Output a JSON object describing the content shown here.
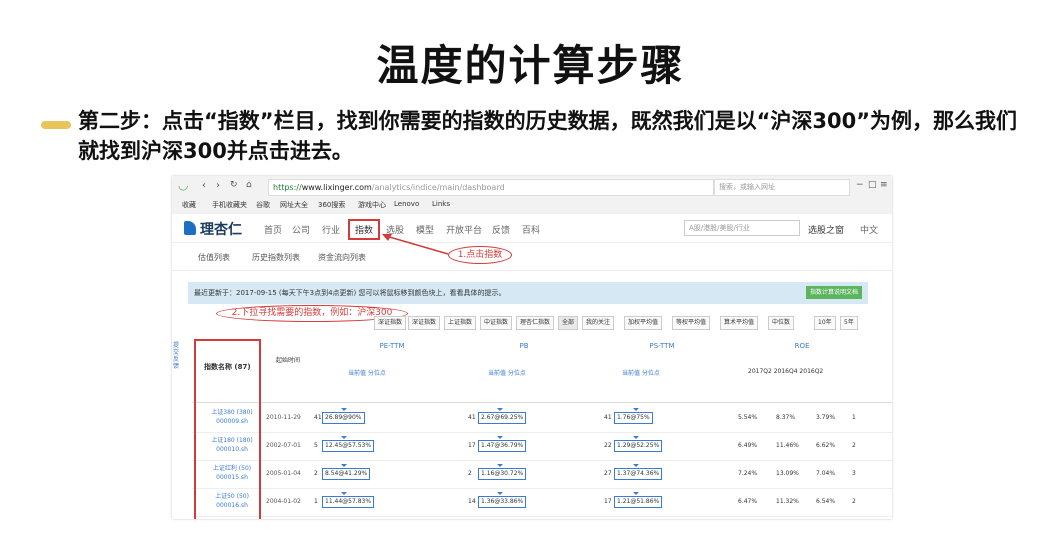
{
  "slide": {
    "title": "温度的计算步骤",
    "step_text": "第二步：点击“指数”栏目，找到你需要的指数的历史数据，既然我们是以“沪深300”为例，那么我们就找到沪深300并点击进去。"
  },
  "browser": {
    "url_scheme": "https://",
    "url_host": "www.lixinger.com",
    "url_path": "/analytics/indice/main/dashboard",
    "bookmarks": [
      "收藏",
      "手机收藏夹",
      "谷歌",
      "网址大全",
      "360搜索",
      "游戏中心",
      "Lenovo",
      "Links"
    ],
    "search_placeholder": "搜索，或输入网址"
  },
  "site": {
    "logo": "理杏仁",
    "nav": [
      "首页",
      "公司",
      "行业",
      "指数",
      "选股",
      "模型",
      "开放平台",
      "反馈",
      "百科"
    ],
    "active_nav": "指数",
    "search_placeholder": "A股/港股/美股/行业",
    "user": "选股之窗",
    "lang": "中文"
  },
  "subtabs": [
    "估值列表",
    "历史指数列表",
    "资金流向列表"
  ],
  "callouts": {
    "click_index": "1.点击指数",
    "scroll_find": "2.下拉寻找需要的指数，例如：沪深300"
  },
  "infobar": {
    "text": "最近更新于：2017-09-15 (每天下午3点到4点更新) 您可以将鼠标移到颜色块上，看看具体的提示。",
    "button": "指数计算说明文档"
  },
  "filters": {
    "left": [
      "深证指数",
      "深证指数",
      "上证指数",
      "中证指数",
      "理杏仁指数",
      "全部",
      "我的关注"
    ],
    "right": [
      "加权平均值",
      "等权平均值",
      "算术平均值",
      "中位数",
      "10年",
      "5年"
    ]
  },
  "table": {
    "col_name": "指数名称 (87)",
    "col_date": "起始时间",
    "groups": [
      "PE-TTM",
      "PB",
      "PS-TTM",
      "ROE"
    ],
    "sub_pe": "当前值  分位点",
    "roe_years": "2017Q2  2016Q4  2016Q2",
    "rows": [
      {
        "name": "上证380 (380)",
        "code": "000009.sh",
        "date": "2010-11-29",
        "pe_n": "41",
        "pe": "26.89@90%",
        "pb_n": "41",
        "pb": "2.67@69.25%",
        "ps_n": "41",
        "ps": "1.76@75%",
        "roe": [
          "5.54%",
          "8.37%",
          "3.79%",
          "1"
        ]
      },
      {
        "name": "上证180 (180)",
        "code": "000010.sh",
        "date": "2002-07-01",
        "pe_n": "5",
        "pe": "12.45@57.53%",
        "pb_n": "17",
        "pb": "1.47@36.79%",
        "ps_n": "22",
        "ps": "1.29@52.25%",
        "roe": [
          "6.49%",
          "11.46%",
          "6.62%",
          "2"
        ]
      },
      {
        "name": "上证红利 (50)",
        "code": "000015.sh",
        "date": "2005-01-04",
        "pe_n": "2",
        "pe": "8.54@41.29%",
        "pb_n": "2",
        "pb": "1.16@30.72%",
        "ps_n": "27",
        "ps": "1.37@74.36%",
        "roe": [
          "7.24%",
          "13.09%",
          "7.04%",
          "3"
        ]
      },
      {
        "name": "上证50 (50)",
        "code": "000016.sh",
        "date": "2004-01-02",
        "pe_n": "1",
        "pe": "11.44@57.83%",
        "pb_n": "14",
        "pb": "1.36@33.86%",
        "ps_n": "17",
        "ps": "1.21@51.86%",
        "roe": [
          "6.47%",
          "11.32%",
          "6.54%",
          "2"
        ]
      }
    ]
  },
  "side_feedback": "提交反馈",
  "colors": {
    "accent_red": "#d53a3a",
    "link_blue": "#3a7bd5",
    "bullet_gold": "#e9c45a"
  }
}
